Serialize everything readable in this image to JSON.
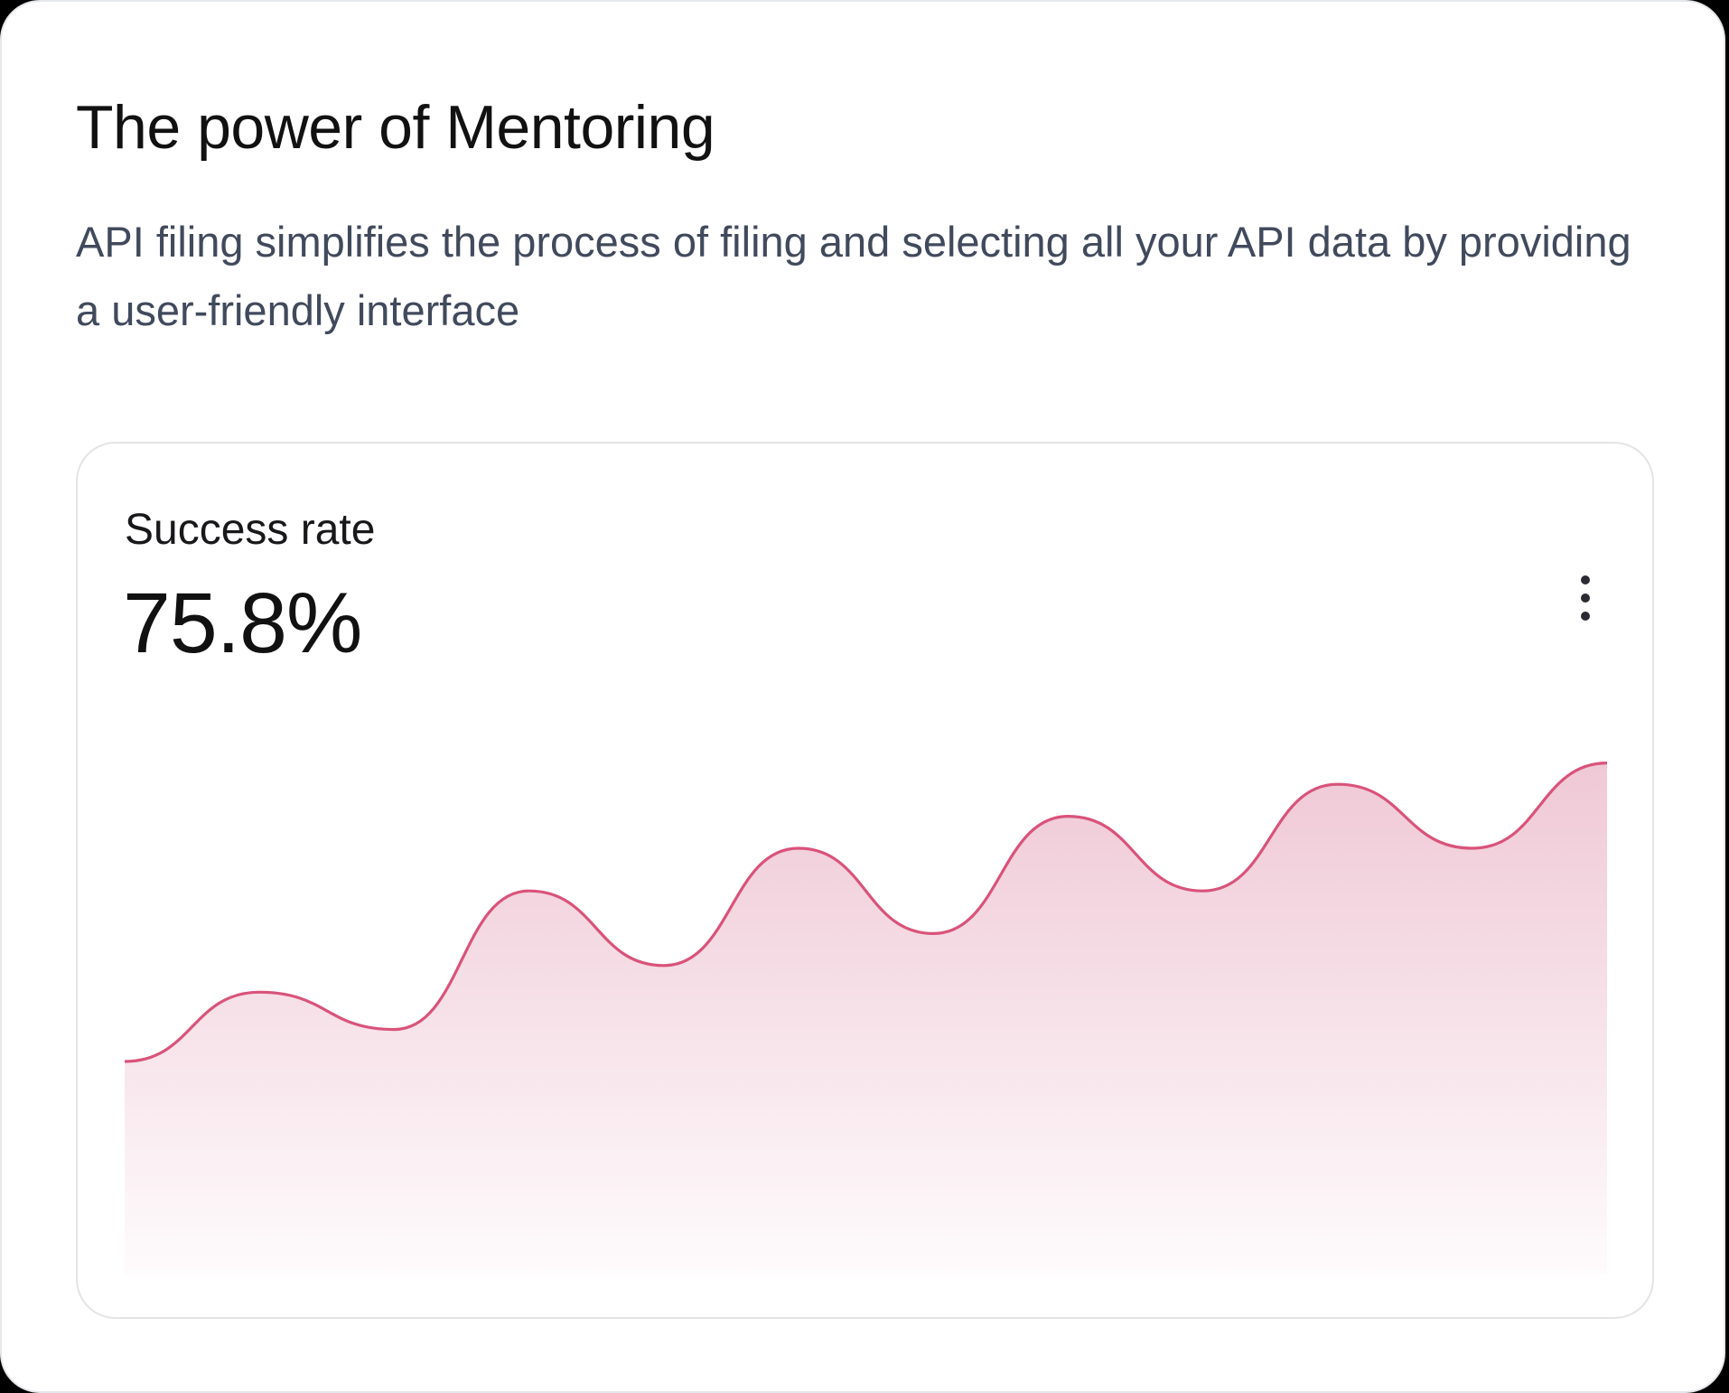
{
  "card": {
    "title": "The power of Mentoring",
    "description": "API filing simplifies the process of filing and selecting all your API data by providing a user-friendly interface"
  },
  "metric": {
    "label": "Success rate",
    "value": "75.8%",
    "more_icon": "more-vertical-icon"
  },
  "colors": {
    "line": "#d9537a",
    "fill": "#eec3d1",
    "card_border": "#e4e4e7"
  },
  "chart_data": {
    "type": "area",
    "title": "",
    "xlabel": "",
    "ylabel": "",
    "grid": false,
    "legend": "none",
    "x": [
      0,
      1,
      2,
      3,
      4,
      5,
      6,
      7,
      8,
      9,
      10,
      11
    ],
    "ylim": [
      0,
      100
    ],
    "series": [
      {
        "values": [
          40,
          53,
          46,
          72,
          58,
          80,
          64,
          86,
          72,
          92,
          80,
          96
        ]
      }
    ]
  }
}
